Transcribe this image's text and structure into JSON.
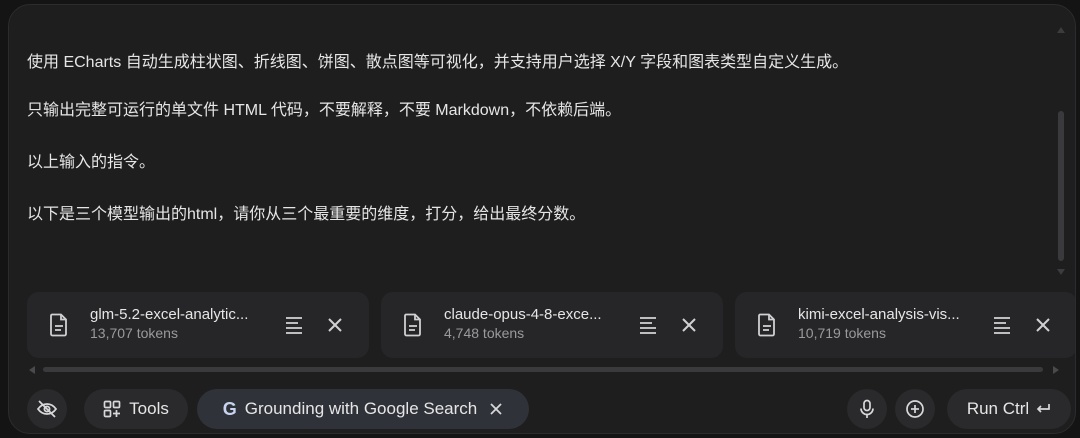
{
  "prompt": {
    "lines": [
      "使用 ECharts 自动生成柱状图、折线图、饼图、散点图等可视化，并支持用户选择 X/Y 字段和图表类型自定义生成。",
      "只输出完整可运行的单文件 HTML 代码，不要解释，不要 Markdown，不依赖后端。",
      "以上输入的指令。",
      "以下是三个模型输出的html，请你从三个最重要的维度，打分，给出最终分数。"
    ]
  },
  "attachments": [
    {
      "name": "glm-5.2-excel-analytic...",
      "tokens": "13,707 tokens"
    },
    {
      "name": "claude-opus-4-8-exce...",
      "tokens": "4,748 tokens"
    },
    {
      "name": "kimi-excel-analysis-vis...",
      "tokens": "10,719 tokens"
    }
  ],
  "toolbar": {
    "tools_label": "Tools",
    "grounding_letter": "G",
    "grounding_label": "Grounding with Google Search",
    "run_label": "Run Ctrl"
  },
  "icons": {
    "visibility": "eye-off-icon",
    "tools": "grid-icon",
    "file": "file-icon",
    "view": "text-lines-icon",
    "close": "close-icon",
    "mic": "mic-icon",
    "add": "add-circle-icon",
    "enter": "enter-icon"
  },
  "colors": {
    "panel": "#1e1e1f",
    "chip": "#262628",
    "grounding_chip": "#2f3238",
    "text": "#e6e6e6",
    "muted": "#9a9a9c"
  }
}
